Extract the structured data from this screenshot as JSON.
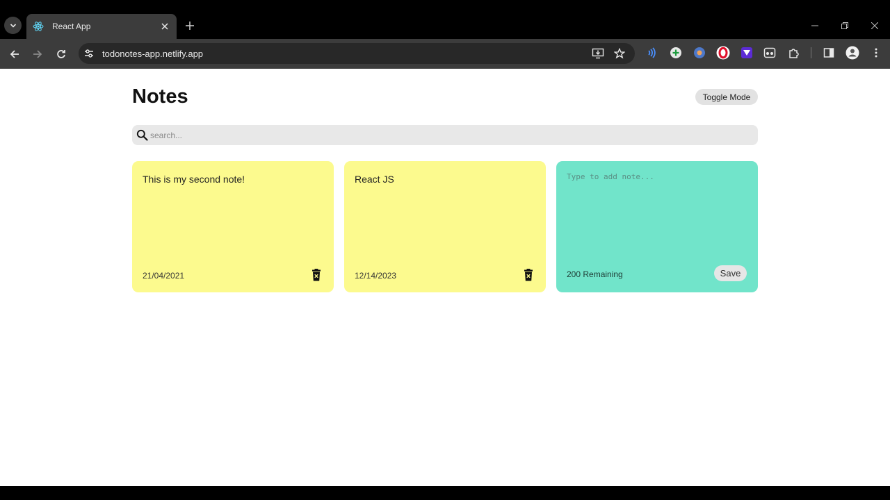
{
  "browser": {
    "tab": {
      "title": "React App",
      "favicon": "react-icon"
    },
    "omnibox": {
      "url": "todonotes-app.netlify.app"
    }
  },
  "page": {
    "title": "Notes",
    "toggle_label": "Toggle Mode",
    "search": {
      "placeholder": "search..."
    },
    "notes": [
      {
        "text": "This is my second note!",
        "date": "21/04/2021"
      },
      {
        "text": "React JS",
        "date": "12/14/2023"
      }
    ],
    "new_note": {
      "placeholder": "Type to add note...",
      "remaining": "200 Remaining",
      "save_label": "Save"
    }
  },
  "colors": {
    "note": "#fcfa8e",
    "new_note": "#71e4ca",
    "search_bg": "#e8e8e8",
    "chrome_bg": "#3c3c3c"
  }
}
